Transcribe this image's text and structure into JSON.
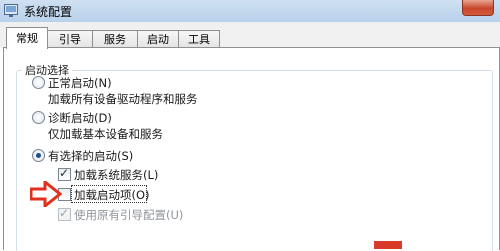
{
  "window": {
    "title": "系统配置",
    "icon": "app-icon"
  },
  "tabs": [
    {
      "label": "常规",
      "active": true
    },
    {
      "label": "引导",
      "active": false
    },
    {
      "label": "服务",
      "active": false
    },
    {
      "label": "启动",
      "active": false
    },
    {
      "label": "工具",
      "active": false
    }
  ],
  "startup_selection": {
    "title": "启动选择",
    "normal": {
      "label": "正常启动(N)",
      "description": "加载所有设备驱动程序和服务",
      "selected": false
    },
    "diagnostic": {
      "label": "诊断启动(D)",
      "description": "仅加载基本设备和服务",
      "selected": false
    },
    "selective": {
      "label": "有选择的启动(S)",
      "selected": true,
      "options": {
        "load_system_services": {
          "label": "加载系统服务(L)",
          "checked": true,
          "enabled": true
        },
        "load_startup_items": {
          "label": "加载启动项(O)",
          "checked": false,
          "enabled": true
        },
        "use_original_boot": {
          "label": "使用原有引导配置(U)",
          "checked": true,
          "enabled": false
        }
      }
    }
  },
  "colors": {
    "annotation_arrow": "#e0301e"
  }
}
